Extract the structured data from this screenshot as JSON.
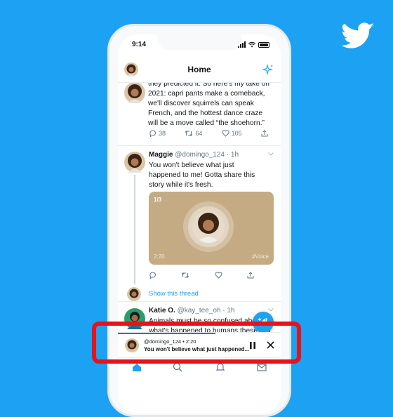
{
  "status_bar": {
    "time": "9:14"
  },
  "header": {
    "title": "Home"
  },
  "tweets": [
    {
      "text": "they predicted it. So here's my take on 2021: capri pants make a comeback, we'll discover squirrels can speak French, and the hottest dance craze will be a move called “the shoehorn.”",
      "replies": "38",
      "retweets": "64",
      "likes": "105"
    },
    {
      "name": "Maggie",
      "handle": "@domingo_124",
      "time": "· 1h",
      "text": "You won't believe what just happened to me! Gotta share this story while it's fresh.",
      "voice_card": {
        "counter": "1/3",
        "duration": "2:20",
        "tag": "#Voice"
      },
      "show_thread": "Show this thread"
    },
    {
      "name": "Katie O.",
      "handle": "@kay_tee_oh",
      "time": "· 1h",
      "text": "Animals must be so confused about what's happened to humans these few months. Do you think bees are organizing fundraisers to “Save the"
    }
  ],
  "player": {
    "subtitle": "@domingo_124 • 2:20",
    "title": "You won't believe what just happened...",
    "progress": 0.6
  },
  "colors": {
    "twitter_blue": "#1da1f2",
    "highlight_red": "#e8121b",
    "voice_purple": "#794bc4",
    "card_tan": "#c4ab83"
  }
}
